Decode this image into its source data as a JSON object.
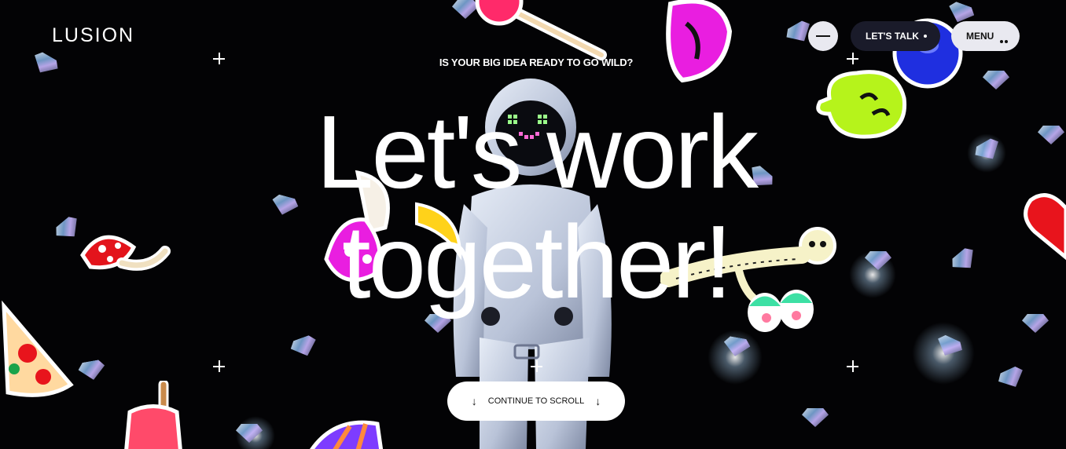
{
  "brand": {
    "logo": "LUSION"
  },
  "header": {
    "theme_toggle_icon": "minus-icon",
    "talk_label": "LET'S TALK",
    "menu_label": "MENU"
  },
  "hero": {
    "tagline": "IS YOUR BIG IDEA READY TO GO WILD?",
    "headline_line1": "Let's work",
    "headline_line2": "together!"
  },
  "scroll_cta": {
    "label": "CONTINUE TO SCROLL",
    "left_icon": "arrow-down-icon",
    "right_icon": "arrow-down-icon",
    "left_glyph": "↓",
    "right_glyph": "↓"
  },
  "stickers": [
    "lollipop",
    "lips",
    "blue-ball",
    "green-alien-face",
    "mushroom",
    "ice-cream-cone",
    "banana",
    "skeleton",
    "eyes",
    "heart",
    "pizza-slice",
    "popsicle",
    "striped-cone"
  ],
  "colors": {
    "background": "#030305",
    "button_light": "#e9e9f0",
    "button_dark": "#1a1b2a",
    "sticker_magenta": "#e91ee0",
    "sticker_lime": "#b6f31b",
    "sticker_blue": "#1f2fe0",
    "sticker_red": "#e8141c"
  }
}
